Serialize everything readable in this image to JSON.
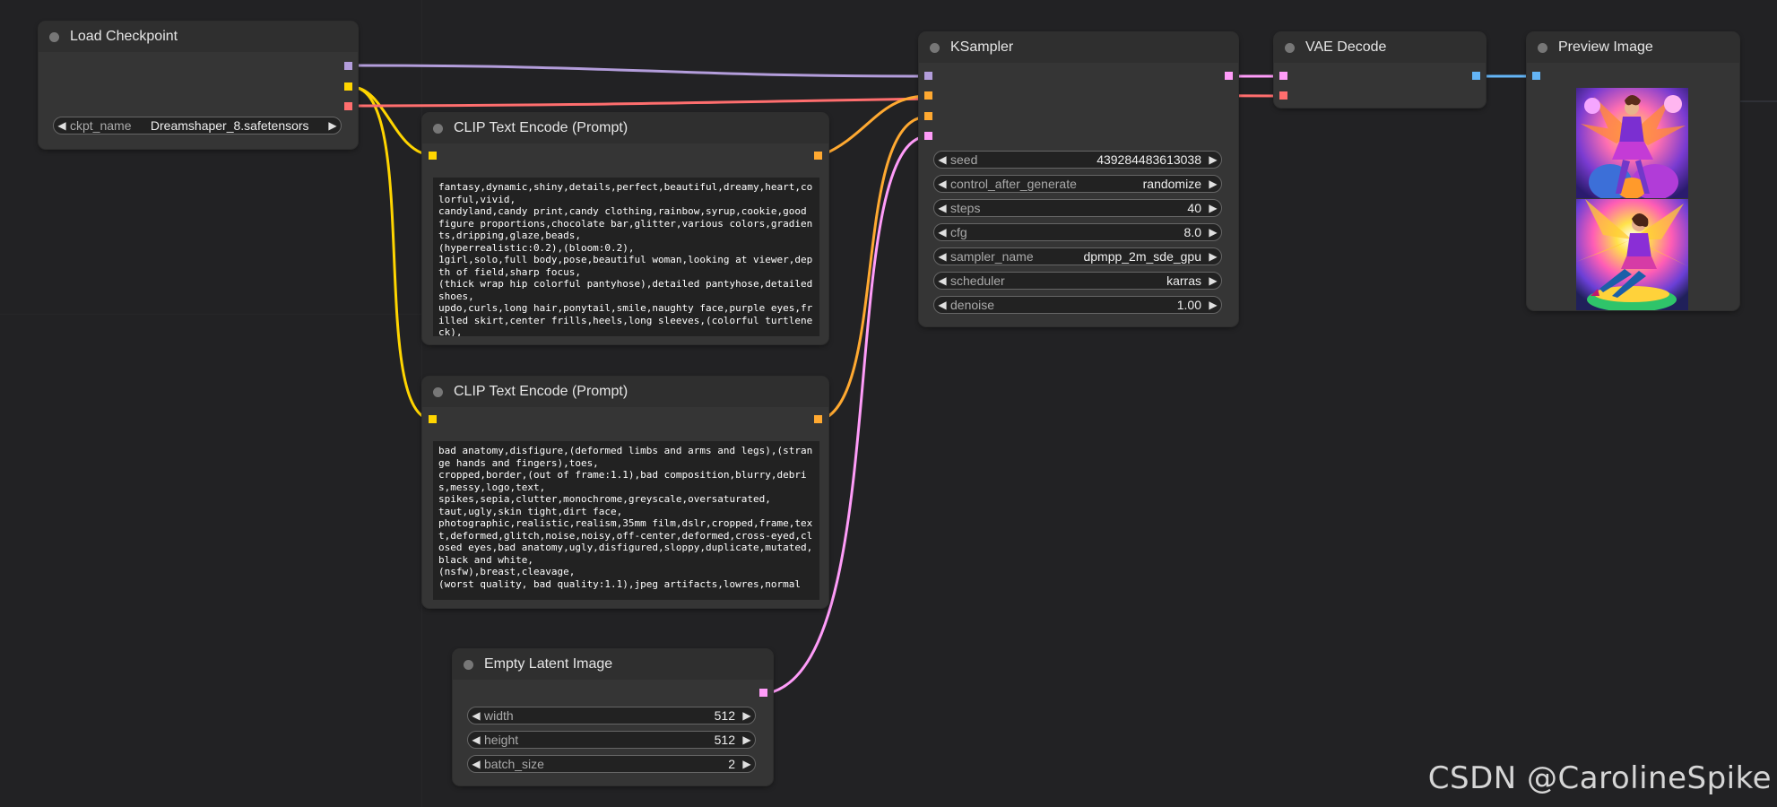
{
  "nodes": {
    "load_checkpoint": {
      "title": "Load Checkpoint",
      "ckpt_name": {
        "label": "ckpt_name",
        "value": "Dreamshaper_8.safetensors"
      }
    },
    "clip_positive": {
      "title": "CLIP Text Encode (Prompt)",
      "text": "fantasy,dynamic,shiny,details,perfect,beautiful,dreamy,heart,colorful,vivid,\ncandyland,candy print,candy clothing,rainbow,syrup,cookie,good figure proportions,chocolate bar,glitter,various colors,gradients,dripping,glaze,beads,\n(hyperrealistic:0.2),(bloom:0.2),\n1girl,solo,full body,pose,beautiful woman,looking at viewer,depth of field,sharp focus,\n(thick wrap hip colorful pantyhose),detailed pantyhose,detailed shoes,\nupdo,curls,long hair,ponytail,smile,naughty face,purple eyes,frilled skirt,center frills,heels,long sleeves,(colorful turtleneck),"
    },
    "clip_negative": {
      "title": "CLIP Text Encode (Prompt)",
      "text": "bad anatomy,disfigure,(deformed limbs and arms and legs),(strange hands and fingers),toes,\ncropped,border,(out of frame:1.1),bad composition,blurry,debris,messy,logo,text,\nspikes,sepia,clutter,monochrome,greyscale,oversaturated,\ntaut,ugly,skin tight,dirt face,\nphotographic,realistic,realism,35mm film,dslr,cropped,frame,text,deformed,glitch,noise,noisy,off-center,deformed,cross-eyed,closed eyes,bad anatomy,ugly,disfigured,sloppy,duplicate,mutated,black and white,\n(nsfw),breast,cleavage,\n(worst quality, bad quality:1.1),jpeg artifacts,lowres,normal"
    },
    "ksampler": {
      "title": "KSampler",
      "widgets": [
        {
          "label": "seed",
          "value": "439284483613038"
        },
        {
          "label": "control_after_generate",
          "value": "randomize"
        },
        {
          "label": "steps",
          "value": "40"
        },
        {
          "label": "cfg",
          "value": "8.0"
        },
        {
          "label": "sampler_name",
          "value": "dpmpp_2m_sde_gpu"
        },
        {
          "label": "scheduler",
          "value": "karras"
        },
        {
          "label": "denoise",
          "value": "1.00"
        }
      ]
    },
    "vae_decode": {
      "title": "VAE Decode"
    },
    "preview_image": {
      "title": "Preview Image"
    },
    "empty_latent": {
      "title": "Empty Latent Image",
      "widgets": [
        {
          "label": "width",
          "value": "512"
        },
        {
          "label": "height",
          "value": "512"
        },
        {
          "label": "batch_size",
          "value": "2"
        }
      ]
    }
  },
  "watermark": "CSDN @CarolineSpike",
  "colors": {
    "background": "#222224",
    "node": "#353535",
    "model": "#b39ddb",
    "clip": "#ffd500",
    "vae": "#ff6e6e",
    "conditioning": "#ffa931",
    "latent": "#ff9cf9",
    "image": "#64b5f6"
  }
}
